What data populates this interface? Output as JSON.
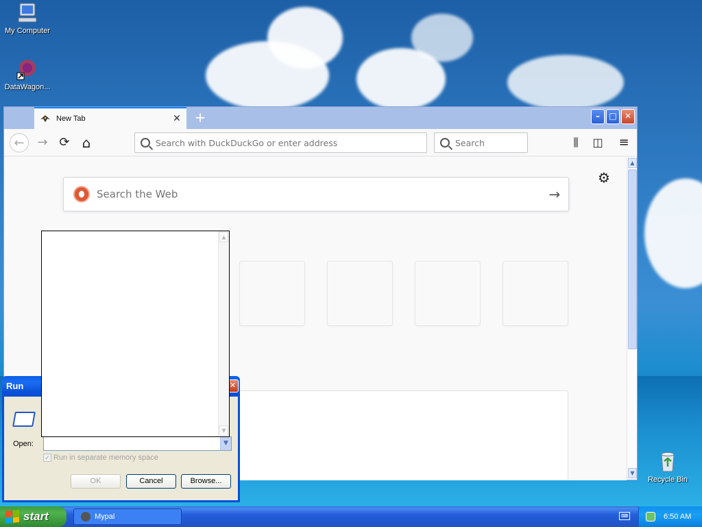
{
  "desktop": {
    "icons": [
      {
        "label": "My Computer"
      },
      {
        "label": "DataWagon..."
      },
      {
        "label": "Recycle Bin"
      }
    ]
  },
  "browser": {
    "tab": {
      "title": "New Tab",
      "close": "✕"
    },
    "new_tab": "+",
    "window_buttons": {
      "minimize": "–",
      "maximize": "□",
      "close": "✕"
    },
    "nav": {
      "back": "←",
      "forward": "→",
      "reload": "⟳",
      "home": "⌂"
    },
    "urlbar": {
      "placeholder": "Search with DuckDuckGo or enter address"
    },
    "searchbar": {
      "placeholder": "Search"
    },
    "toolbar": {
      "library": "⫼",
      "sidebar": "◫",
      "menu": "≡"
    },
    "newtab": {
      "settings": "⚙",
      "web_search": {
        "placeholder": "Search the Web",
        "go": "→"
      },
      "tiles": 4
    }
  },
  "run_dialog": {
    "title": "Run",
    "close": "✕",
    "open_label": "Open:",
    "open_value": "",
    "checkbox_label": "Run in separate memory space",
    "checkbox_checked": true,
    "buttons": {
      "ok": "OK",
      "cancel": "Cancel",
      "browse": "Browse..."
    }
  },
  "taskbar": {
    "start": "start",
    "tasks": [
      {
        "label": "Mypal"
      }
    ],
    "clock": "6:50 AM"
  },
  "colors": {
    "xp_blue": "#0a4fd6",
    "start_green": "#3c9a3c",
    "firefox_blue": "#0a84ff"
  }
}
